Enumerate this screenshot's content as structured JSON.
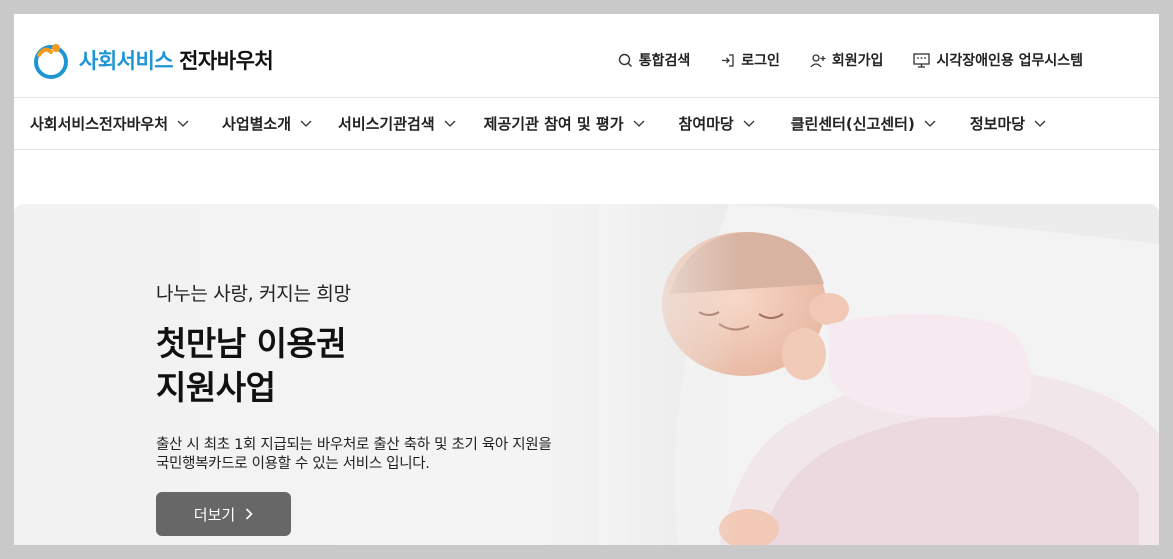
{
  "header": {
    "logo_blue": "사회서비스",
    "logo_dark": "전자바우처",
    "util_links": [
      {
        "label": "통합검색",
        "icon": "search-icon"
      },
      {
        "label": "로그인",
        "icon": "login-icon"
      },
      {
        "label": "회원가입",
        "icon": "user-plus-icon"
      },
      {
        "label": "시각장애인용 업무시스템",
        "icon": "monitor-icon"
      }
    ]
  },
  "nav": {
    "items": [
      {
        "label": "사회서비스전자바우처"
      },
      {
        "label": "사업별소개"
      },
      {
        "label": "서비스기관검색"
      },
      {
        "label": "제공기관 참여 및 평가"
      },
      {
        "label": "참여마당"
      },
      {
        "label": "클린센터(신고센터)"
      },
      {
        "label": "정보마당"
      }
    ]
  },
  "hero": {
    "subtitle": "나누는 사랑, 커지는 희망",
    "title_line1": "첫만남 이용권",
    "title_line2": "지원사업",
    "desc_line1": "출산 시 최초 1회 지급되는 바우처로 출산 축하 및 초기 육아 지원을",
    "desc_line2": "국민행복카드로 이용할 수 있는 서비스 입니다.",
    "more_label": "더보기"
  },
  "colors": {
    "brand_blue": "#1e96d4",
    "brand_orange": "#f39a1e",
    "button_gray": "#676767"
  }
}
